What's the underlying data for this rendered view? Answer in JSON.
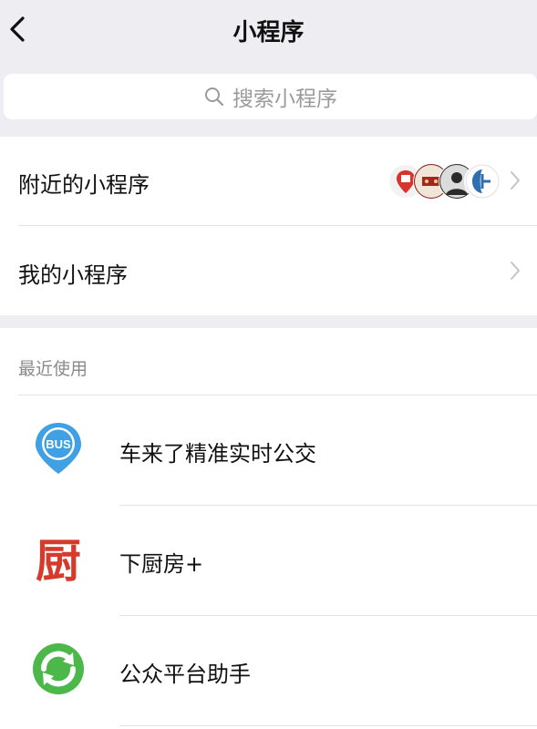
{
  "nav": {
    "title": "小程序",
    "back_icon": "chevron-left-icon"
  },
  "search": {
    "placeholder": "搜索小程序",
    "icon": "search-icon"
  },
  "menu": {
    "nearby": {
      "label": "附近的小程序",
      "avatar_count": 4
    },
    "mine": {
      "label": "我的小程序"
    }
  },
  "recent": {
    "header": "最近使用",
    "apps": [
      {
        "name": "车来了精准实时公交",
        "icon": "bus-location-icon",
        "icon_label": "BUS",
        "color": "#3FA0E3"
      },
      {
        "name": "下厨房+",
        "icon": "kitchen-icon",
        "icon_label": "厨",
        "color": "#D63A2B"
      },
      {
        "name": "公众平台助手",
        "icon": "green-arrows-icon",
        "color": "#4CB849"
      }
    ]
  },
  "colors": {
    "background": "#EDEDF2",
    "panel": "#FFFFFF",
    "text_primary": "#111111",
    "text_secondary": "#8A8A8A",
    "placeholder": "#9B9B9B"
  }
}
